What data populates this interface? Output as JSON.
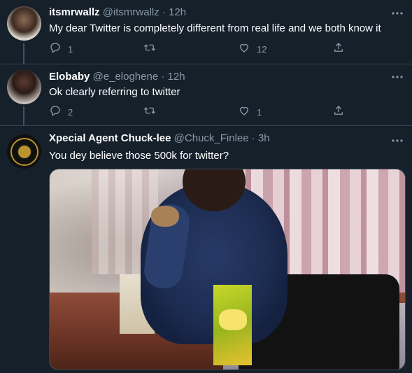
{
  "tweets": [
    {
      "name": "itsmrwallz",
      "handle": "@itsmrwallz",
      "separator": "·",
      "time": "12h",
      "text": "My dear Twitter is completely different from real life and we both know it",
      "replies": "1",
      "retweets": "",
      "likes": "12"
    },
    {
      "name": "Elobaby",
      "handle": "@e_eloghene",
      "separator": "·",
      "time": "12h",
      "text": "Ok clearly referring to twitter",
      "replies": "2",
      "retweets": "",
      "likes": "1"
    },
    {
      "name": "Xpecial Agent Chuck-lee",
      "handle": "@Chuck_Finlee",
      "separator": "·",
      "time": "3h",
      "text": "You dey believe those 500k for twitter?"
    }
  ],
  "icons": {
    "more": "more-dots-icon",
    "reply": "reply-icon",
    "retweet": "retweet-icon",
    "like": "heart-icon",
    "share": "share-icon"
  },
  "colors": {
    "background": "#15202b",
    "muted_text": "#8899a6",
    "divider": "#38444d",
    "thread_line": "#3d5466"
  }
}
